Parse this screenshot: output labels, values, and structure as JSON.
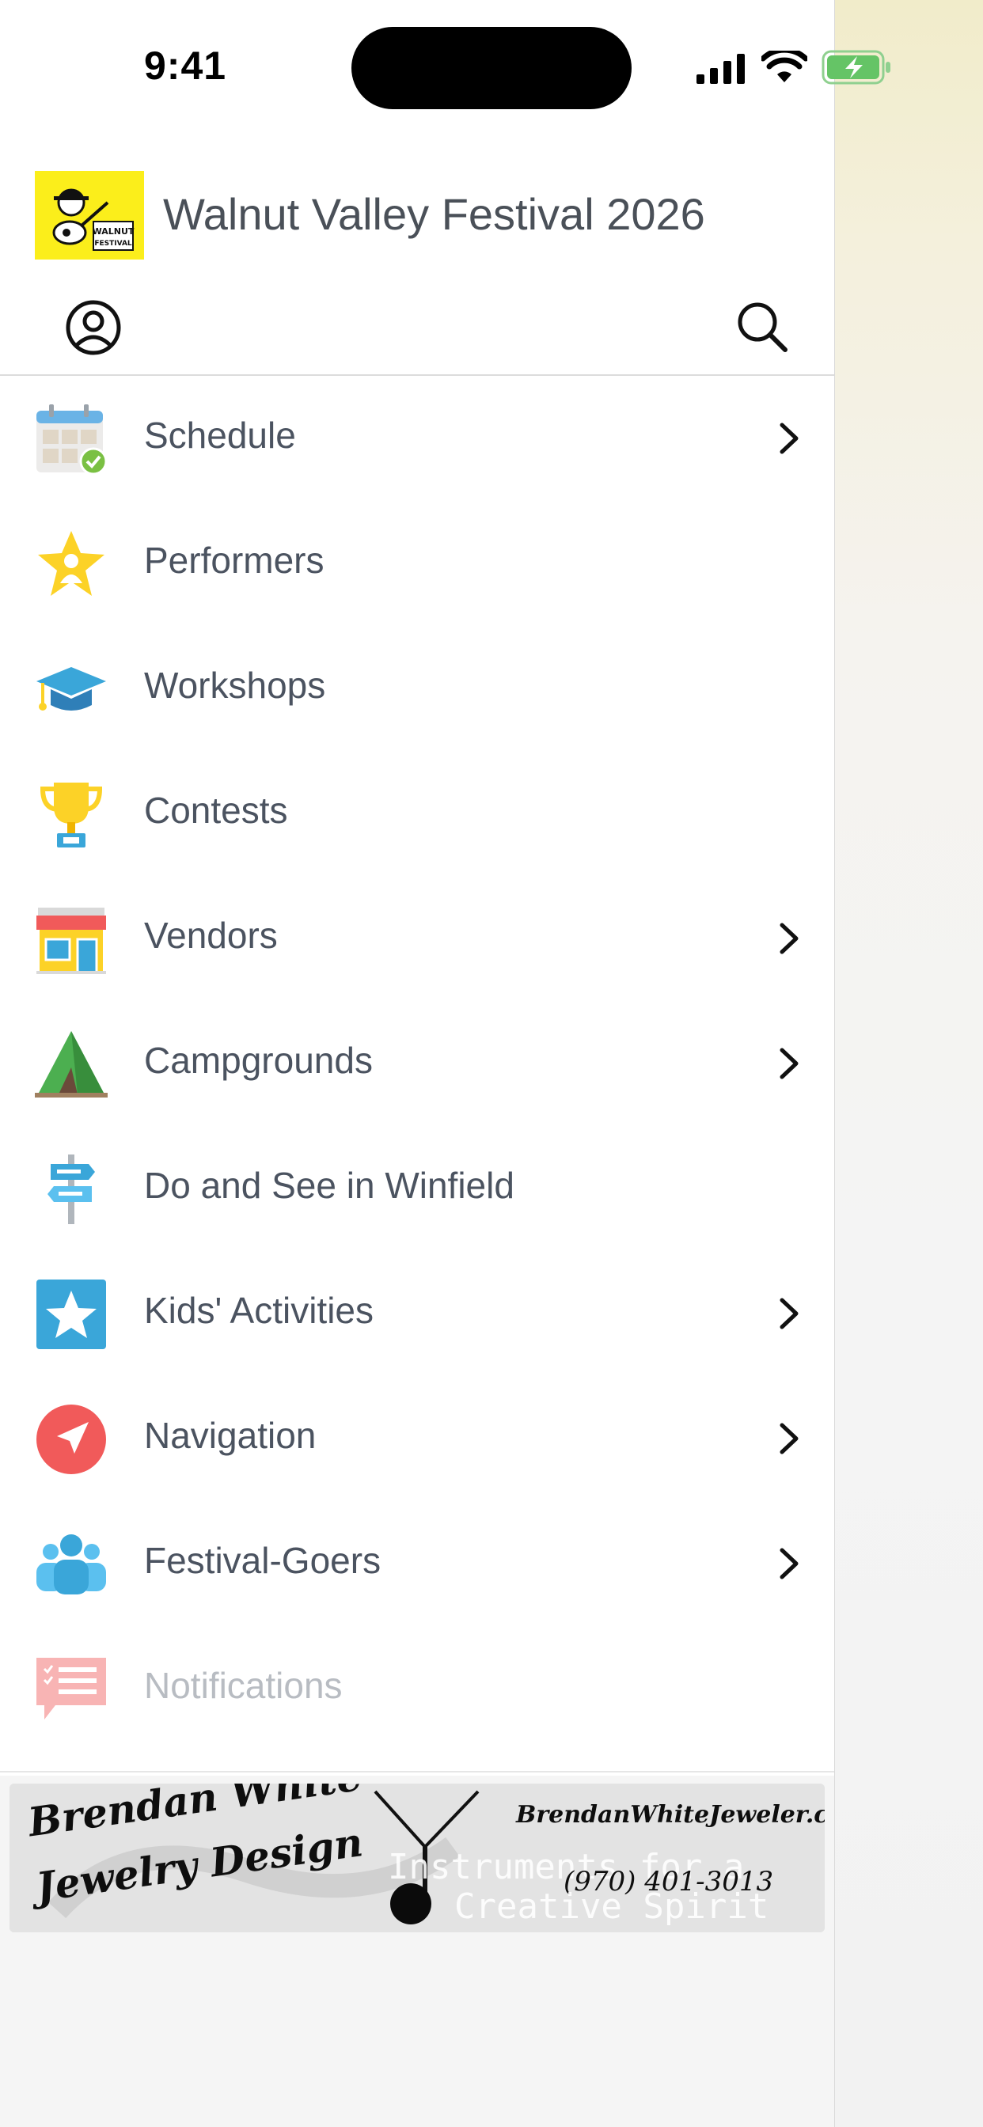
{
  "status_bar": {
    "time": "9:41"
  },
  "header": {
    "title": "Walnut Valley Festival 2026",
    "logo_name": "walnut-valley-festival-logo",
    "profile_icon": "person-circle-icon",
    "search_icon": "search-icon"
  },
  "menu": {
    "items": [
      {
        "label": "Schedule",
        "icon": "calendar-check-icon",
        "has_chevron": true
      },
      {
        "label": "Performers",
        "icon": "star-person-icon",
        "has_chevron": false
      },
      {
        "label": "Workshops",
        "icon": "graduation-cap-icon",
        "has_chevron": false
      },
      {
        "label": "Contests",
        "icon": "trophy-icon",
        "has_chevron": false
      },
      {
        "label": "Vendors",
        "icon": "storefront-icon",
        "has_chevron": true
      },
      {
        "label": "Campgrounds",
        "icon": "tent-icon",
        "has_chevron": true
      },
      {
        "label": "Do and See in Winfield",
        "icon": "signpost-icon",
        "has_chevron": false
      },
      {
        "label": "Kids' Activities",
        "icon": "star-badge-icon",
        "has_chevron": true
      },
      {
        "label": "Navigation",
        "icon": "location-arrow-icon",
        "has_chevron": true
      },
      {
        "label": "Festival-Goers",
        "icon": "people-group-icon",
        "has_chevron": true
      },
      {
        "label": "Notifications",
        "icon": "message-list-icon",
        "has_chevron": false,
        "dimmed": true
      }
    ]
  },
  "ad": {
    "brand_line1": "Brendan White",
    "brand_line2": "Jewelry Design",
    "website": "BrendanWhiteJeweler.com",
    "phone": "(970) 401-3013",
    "overlay_line1": "Instruments for a",
    "overlay_line2": "Creative Spirit"
  },
  "colors": {
    "label": "#4b5360",
    "title": "#4a5058",
    "logo_bg": "#fbee1b",
    "battery_green": "#65c466"
  }
}
